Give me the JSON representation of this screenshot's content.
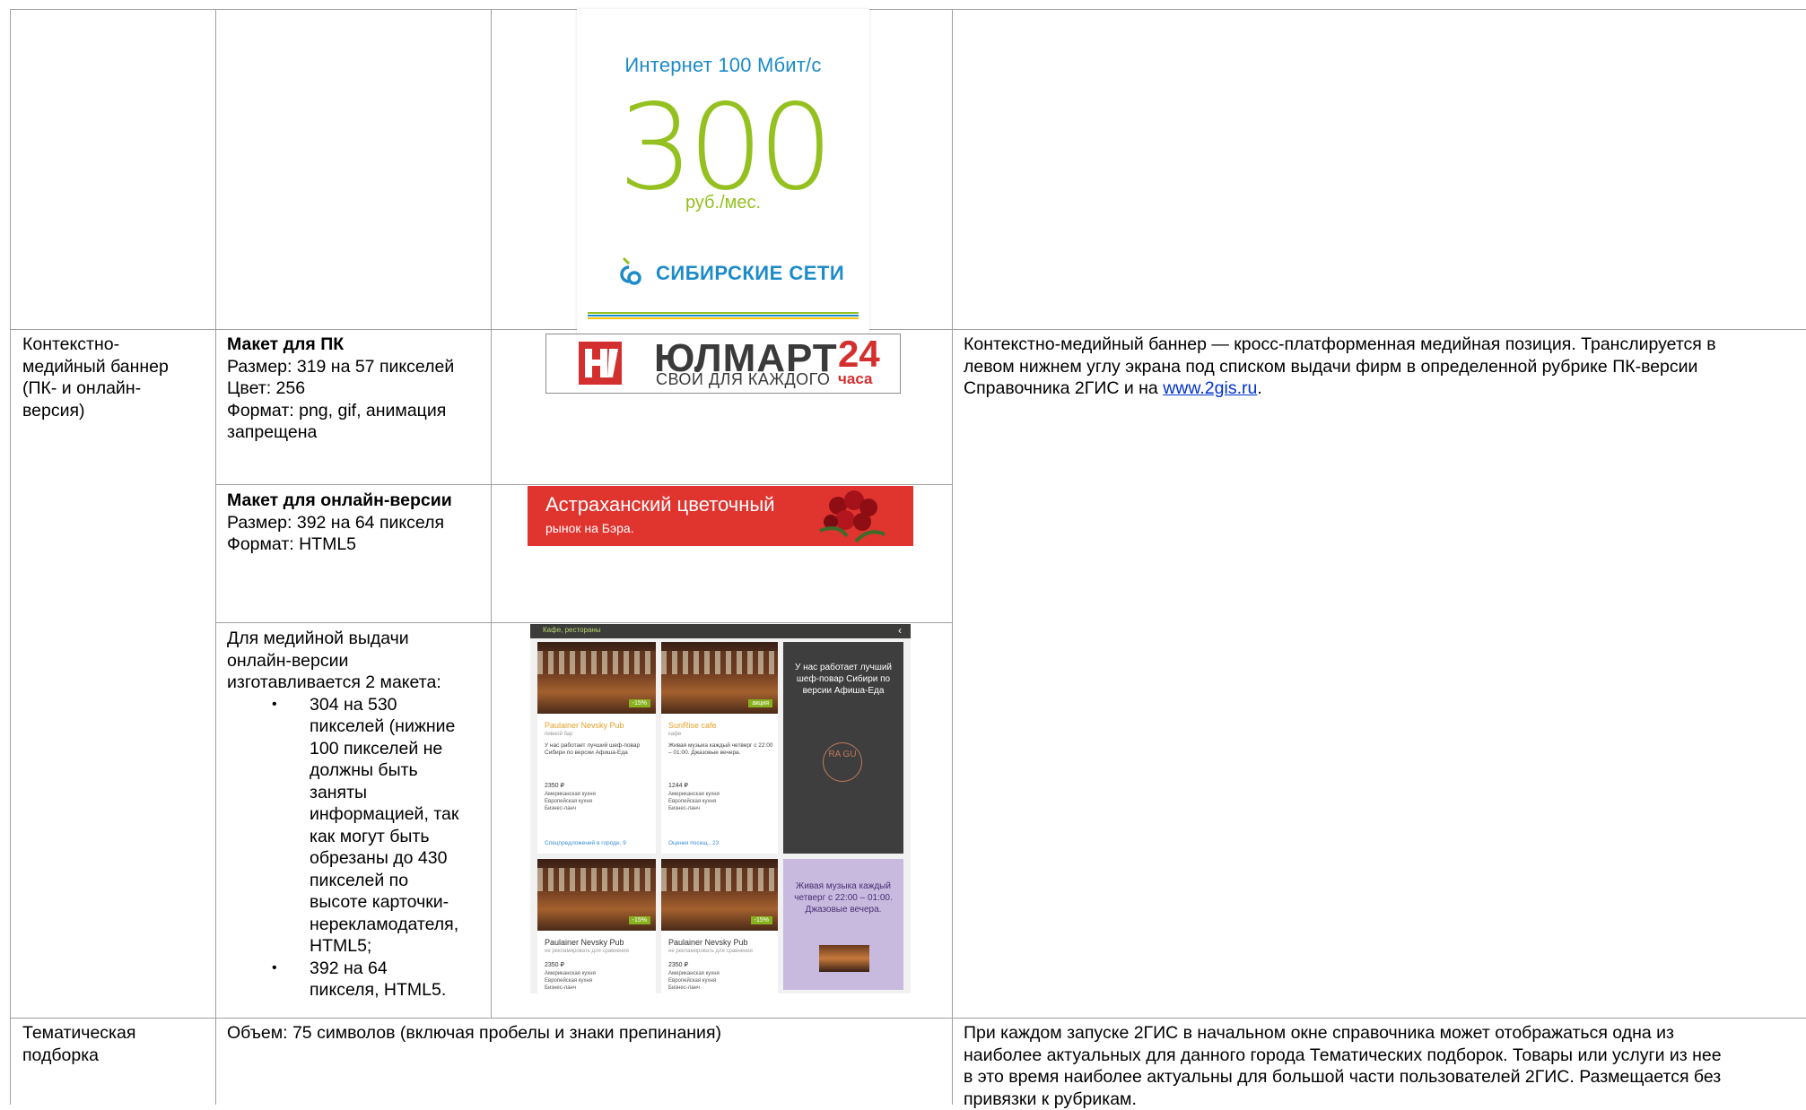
{
  "table": {
    "rows": [
      {
        "name": "Контекстно-медийный баннер (ПК- и онлайн-версия)",
        "name_lines": [
          "Контекстно-",
          "медийный баннер",
          "(ПК- и онлайн-",
          "версия)"
        ],
        "description_before": "Контекстно-медийный баннер — кросс-платформенная медийная позиция. Транслируется в левом нижнем углу экрана под списком выдачи фирм в определенной рубрике ПК-версии Справочника 2ГИС и на ",
        "description_link": "www.2gis.ru",
        "description_after": ".",
        "desc_lines": [
          "Контекстно-медийный баннер — кросс-платформенная медийная позиция. Транслируется в",
          "левом нижнем углу экрана под списком выдачи фирм в определенной рубрике ПК-версии",
          "Справочника 2ГИС и на "
        ],
        "pc": {
          "heading": "Макет для ПК",
          "size": "Размер: 319 на 57 пикселей",
          "color": "Цвет: 256",
          "format_lines": [
            "Формат: png, gif, анимация",
            "запрещена"
          ]
        },
        "online": {
          "heading": "Макет для онлайн-версии",
          "size": "Размер: 392 на 64 пикселя",
          "format": "Формат: HTML5"
        },
        "media": {
          "intro_lines": [
            "Для медийной выдачи",
            "онлайн-версии",
            "изготавливается 2 макета:"
          ],
          "bullet1_lines": [
            "304 на 530",
            "пикселей (нижние",
            "100 пикселей не",
            "должны быть",
            "заняты",
            "информацией, так",
            "как могут быть",
            "обрезаны до 430",
            "пикселей по",
            "высоте карточки-",
            "нерекламодателя,",
            "HTML5;"
          ],
          "bullet2_lines": [
            "392 на 64",
            "пикселя, HTML5."
          ]
        }
      },
      {
        "name_lines": [
          "Тематическая",
          "подборка"
        ],
        "requirements": "Объем: 75 символов (включая пробелы и знаки препинания)",
        "desc_lines": [
          "При каждом запуске 2ГИС в начальном окне справочника может отображаться одна из",
          "наиболее актуальных для данного города Тематических подборок. Товары или услуги из нее",
          "в это время наиболее актуальны для большой части пользователей 2ГИС. Размещается без",
          "привязки к рубрикам."
        ]
      }
    ]
  },
  "banners": {
    "sibirskie": {
      "headline": "Интернет 100 Мбит/с",
      "price": "300",
      "unit": "руб./мес.",
      "brand": "СИБИРСКИЕ СЕТИ"
    },
    "yulmart": {
      "name": "ЮЛМАРТ",
      "slogan": "СВОЙ ДЛЯ КАЖДОГО",
      "hours_num": "24",
      "hours_word": "часа"
    },
    "astrakhan": {
      "line1": "Астраханский цветочный",
      "line2": "рынок на Бэра."
    },
    "mockup": {
      "crumb": "Кафе, рестораны",
      "cards": [
        {
          "title": "Paulainer Nevsky Pub",
          "sub": "пивной бар",
          "desc": "У нас работает лучший шеф-повар Сибири по версии Афиша-Еда",
          "price": "2350 ₽",
          "lines": [
            "Американская кухня",
            "Европейская кухня",
            "Бизнес-ланч"
          ],
          "badge": "-15%",
          "foot": "Спецпредложений в городе, 9"
        },
        {
          "title": "SunRise cafe",
          "sub": "кафе",
          "desc": "Живая музыка каждый четверг с 22:00 – 01:00. Джазовые вечера.",
          "price": "1244 ₽",
          "lines": [
            "Американская кухня",
            "Европейская кухня",
            "Бизнес-ланч"
          ],
          "badge": "акция",
          "foot": "Оценки посещ., 23"
        },
        {
          "title": "Paulainer Nevsky Pub",
          "sub": "не рекламировать для сравнения",
          "price": "2350 ₽",
          "lines": [
            "Американская кухня",
            "Европейская кухня",
            "Бизнес-ланч"
          ],
          "badge": "-15%"
        },
        {
          "title": "Paulainer Nevsky Pub",
          "sub": "не рекламировать для сравнения",
          "price": "2350 ₽",
          "lines": [
            "Американская кухня",
            "Европейская кухня",
            "Бизнес-ланч"
          ],
          "badge": "-15%"
        }
      ],
      "ad_dark": "У нас работает лучший шеф-повар Сибири по версии Афиша-Еда",
      "ad_dark_logo": "RA GU",
      "ad_light": "Живая музыка каждый четверг с 22:00 – 01:00. Джазовые вечера."
    }
  },
  "colors": {
    "grid": "#a0a0a0",
    "sib_blue": "#1c8bc8",
    "sib_green": "#94c11f",
    "yul_red": "#d42f2f",
    "ast_red": "#e0342f",
    "link": "#0033cc"
  }
}
